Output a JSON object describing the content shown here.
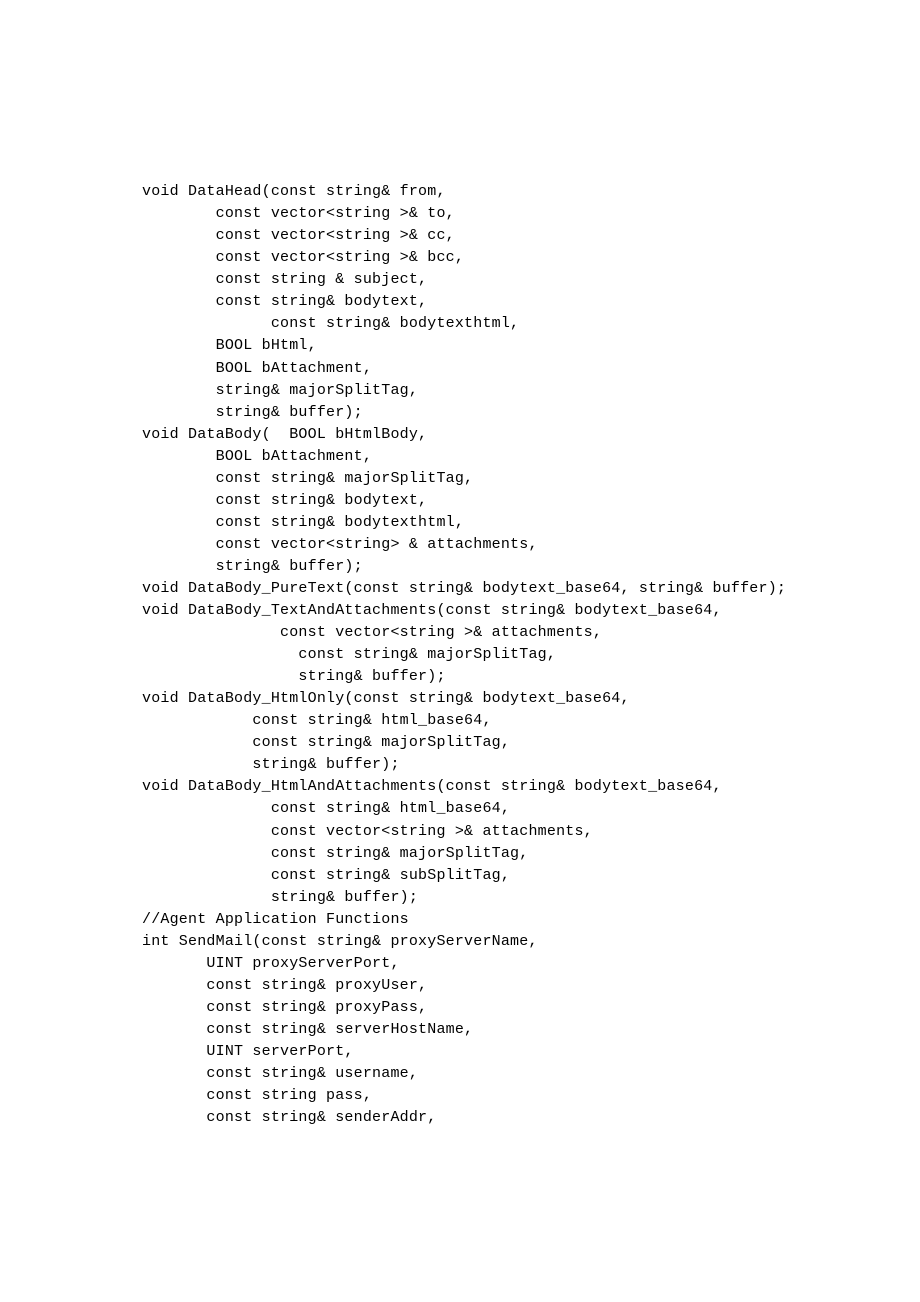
{
  "code": {
    "lines": [
      "void DataHead(const string& from,",
      "        const vector<string >& to,",
      "        const vector<string >& cc,",
      "        const vector<string >& bcc,",
      "        const string & subject,",
      "        const string& bodytext,",
      "              const string& bodytexthtml,",
      "        BOOL bHtml,",
      "        BOOL bAttachment,",
      "        string& majorSplitTag,",
      "        string& buffer);",
      "void DataBody(  BOOL bHtmlBody,",
      "        BOOL bAttachment,",
      "        const string& majorSplitTag,",
      "        const string& bodytext,",
      "        const string& bodytexthtml,",
      "        const vector<string> & attachments,",
      "        string& buffer);",
      "void DataBody_PureText(const string& bodytext_base64, string& buffer);",
      "void DataBody_TextAndAttachments(const string& bodytext_base64,",
      "               const vector<string >& attachments,",
      "                 const string& majorSplitTag,",
      "                 string& buffer);",
      "void DataBody_HtmlOnly(const string& bodytext_base64,",
      "            const string& html_base64,",
      "            const string& majorSplitTag,",
      "            string& buffer);",
      "void DataBody_HtmlAndAttachments(const string& bodytext_base64,",
      "              const string& html_base64,",
      "              const vector<string >& attachments,",
      "              const string& majorSplitTag,",
      "              const string& subSplitTag,",
      "              string& buffer);",
      "",
      "//Agent Application Functions",
      "int SendMail(const string& proxyServerName,",
      "       UINT proxyServerPort,",
      "       const string& proxyUser,",
      "       const string& proxyPass,",
      "       const string& serverHostName,",
      "       UINT serverPort,",
      "       const string& username,",
      "       const string pass,",
      "       const string& senderAddr,"
    ]
  }
}
